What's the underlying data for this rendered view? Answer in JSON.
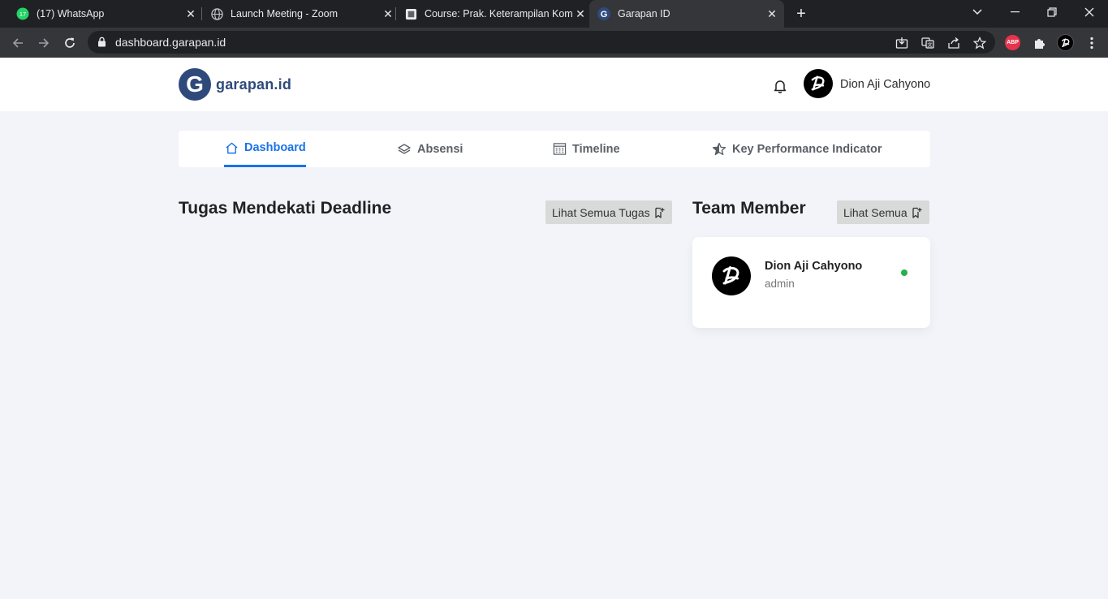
{
  "browser": {
    "tabs": [
      {
        "title": "(17) WhatsApp",
        "icon": "whatsapp-icon",
        "badge": "17",
        "active": false
      },
      {
        "title": "Launch Meeting - Zoom",
        "icon": "globe-icon",
        "active": false
      },
      {
        "title": "Course: Prak. Keterampilan Komunikasi",
        "icon": "course-icon",
        "active": false
      },
      {
        "title": "Garapan ID",
        "icon": "garapan-favicon",
        "favicon_letter": "G",
        "active": true
      }
    ],
    "url": "dashboard.garapan.id",
    "extension_abp_label": "ABP"
  },
  "header": {
    "logo_letter": "G",
    "logo_text": "garapan.id",
    "user_name": "Dion Aji Cahyono",
    "avatar_letter": "D"
  },
  "nav": {
    "items": [
      {
        "label": "Dashboard",
        "icon": "home-icon",
        "active": true
      },
      {
        "label": "Absensi",
        "icon": "layers-icon",
        "active": false
      },
      {
        "label": "Timeline",
        "icon": "calendar-icon",
        "active": false
      },
      {
        "label": "Key Performance Indicator",
        "icon": "star-icon",
        "active": false
      }
    ]
  },
  "tasks": {
    "title": "Tugas Mendekati Deadline",
    "view_all_label": "Lihat Semua Tugas"
  },
  "team": {
    "title": "Team Member",
    "view_all_label": "Lihat Semua",
    "members": [
      {
        "name": "Dion Aji Cahyono",
        "role": "admin",
        "status": "online",
        "avatar_letter": "D"
      }
    ]
  },
  "colors": {
    "accent": "#1a73e8",
    "brand": "#2f4a7a",
    "page_bg": "#f3f4f9",
    "online": "#22b14c",
    "button_gray": "#d7dad8"
  }
}
